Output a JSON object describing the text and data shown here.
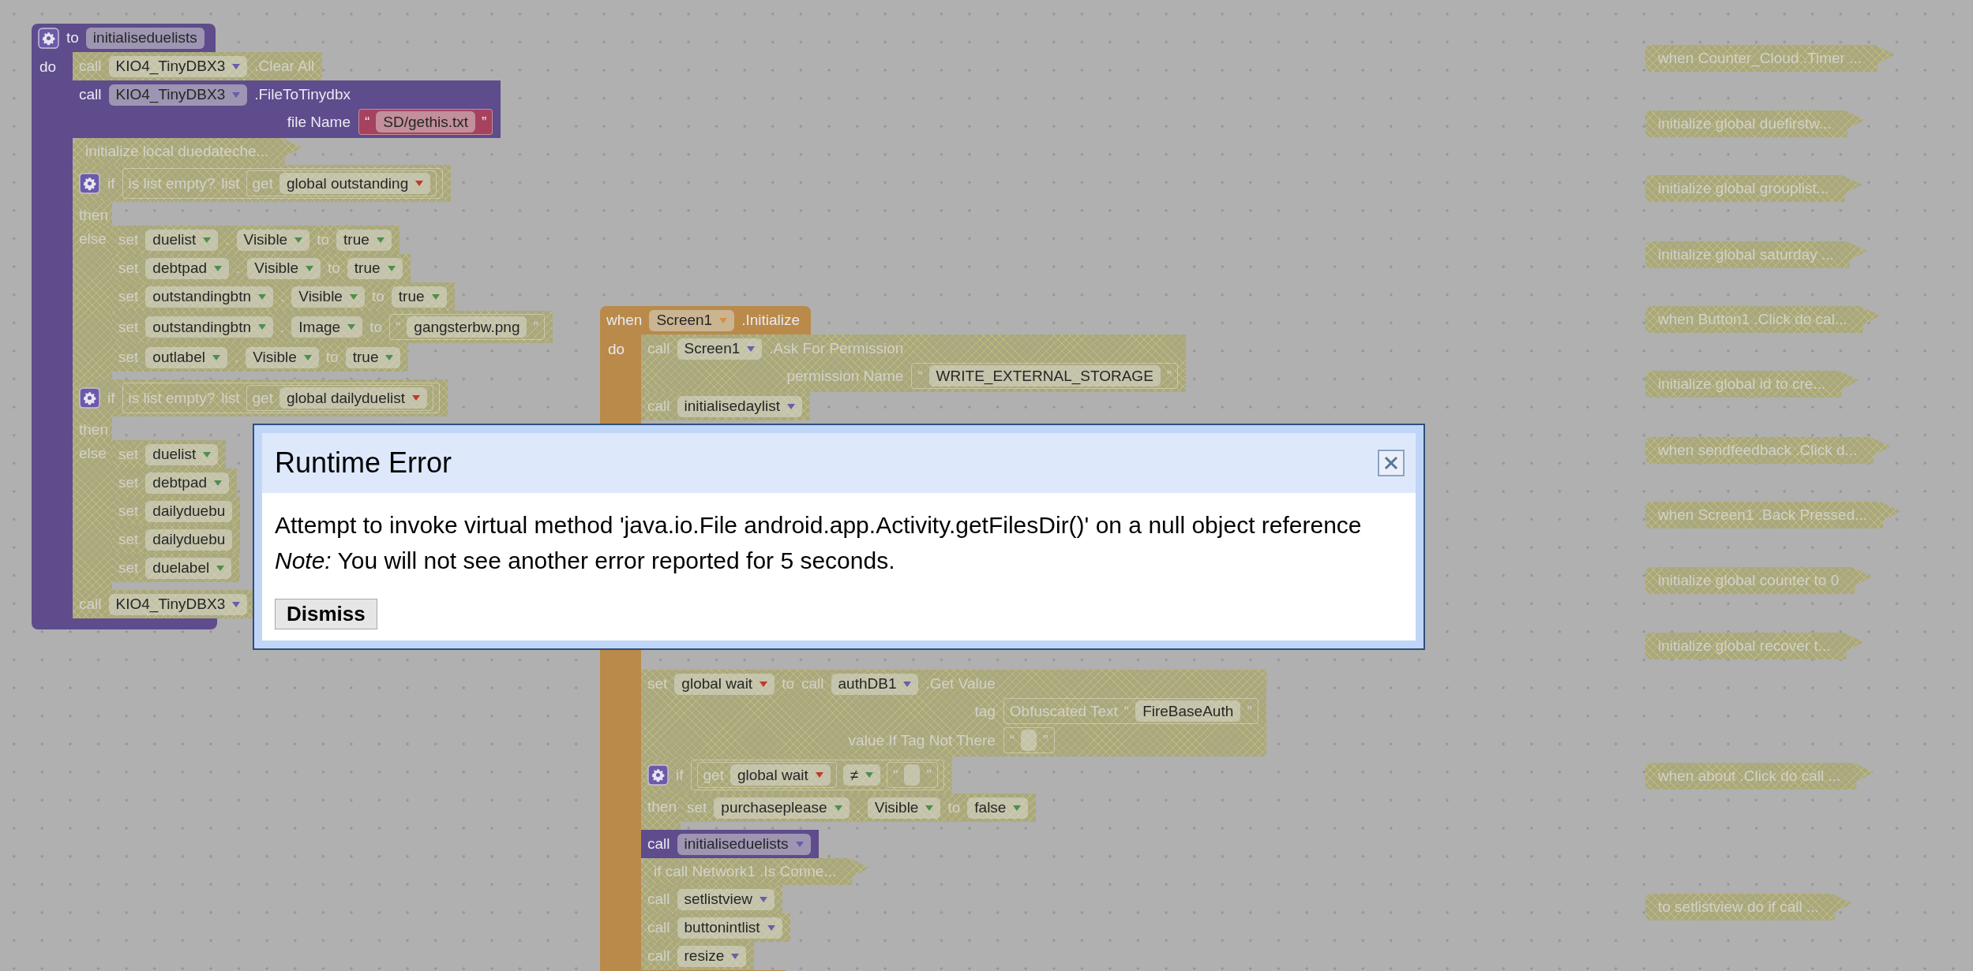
{
  "workspace": {
    "stacks": [
      {
        "kind": "procedure",
        "disabled": false,
        "color": "#5e4c8c",
        "header": [
          {
            "kind": "gear"
          },
          {
            "kind": "word",
            "text": "to"
          },
          {
            "kind": "field",
            "text": "initialiseduelists"
          }
        ],
        "body_label": "do",
        "rows": [
          {
            "kind": "statement",
            "disabled": true,
            "lines": [
              [
                {
                  "kind": "word",
                  "text": "call"
                },
                {
                  "kind": "field",
                  "text": "KIO4_TinyDBX3",
                  "color": "#6d5ca8"
                },
                {
                  "kind": "word",
                  "text": ".Clear All"
                }
              ]
            ]
          },
          {
            "kind": "statement",
            "disabled": false,
            "color": "#5e4c8c",
            "lines": [
              [
                {
                  "kind": "word",
                  "text": "call"
                },
                {
                  "kind": "field",
                  "text": "KIO4_TinyDBX3",
                  "color": "#6d5ca8"
                },
                {
                  "kind": "word",
                  "text": ".FileToTinydbx"
                }
              ],
              [
                {
                  "kind": "word",
                  "text": "file Name"
                },
                {
                  "kind": "value",
                  "color": "#a6415e",
                  "tokens": [
                    {
                      "kind": "word",
                      "text": "“"
                    },
                    {
                      "kind": "string",
                      "text": "SD/gethis.txt"
                    },
                    {
                      "kind": "word",
                      "text": "”"
                    }
                  ]
                }
              ]
            ]
          },
          {
            "kind": "collapsed",
            "disabled": true,
            "text": "initialize local duedateche..."
          },
          {
            "kind": "statement",
            "disabled": true,
            "lines": [
              [
                {
                  "kind": "gear"
                },
                {
                  "kind": "word",
                  "text": "if"
                },
                {
                  "kind": "value",
                  "tokens": [
                    {
                      "kind": "word",
                      "text": "is list empty?"
                    },
                    {
                      "kind": "word",
                      "text": "list"
                    },
                    {
                      "kind": "value",
                      "tokens": [
                        {
                          "kind": "word",
                          "text": "get"
                        },
                        {
                          "kind": "field",
                          "text": "global outstanding",
                          "color": "#c0392b"
                        }
                      ]
                    }
                  ]
                }
              ]
            ],
            "sections": [
              {
                "label": "then"
              },
              {
                "label": "else",
                "rows": [
                  {
                    "kind": "statement",
                    "disabled": true,
                    "lines": [
                      [
                        {
                          "kind": "word",
                          "text": "set"
                        },
                        {
                          "kind": "field",
                          "text": "duelist",
                          "color": "#4d8f4d"
                        },
                        {
                          "kind": "word",
                          "text": "."
                        },
                        {
                          "kind": "field",
                          "text": "Visible",
                          "color": "#4d8f4d"
                        },
                        {
                          "kind": "word",
                          "text": "to"
                        },
                        {
                          "kind": "field",
                          "text": "true",
                          "color": "#4d8f4d"
                        }
                      ]
                    ]
                  },
                  {
                    "kind": "statement",
                    "disabled": true,
                    "lines": [
                      [
                        {
                          "kind": "word",
                          "text": "set"
                        },
                        {
                          "kind": "field",
                          "text": "debtpad",
                          "color": "#4d8f4d"
                        },
                        {
                          "kind": "word",
                          "text": "."
                        },
                        {
                          "kind": "field",
                          "text": "Visible",
                          "color": "#4d8f4d"
                        },
                        {
                          "kind": "word",
                          "text": "to"
                        },
                        {
                          "kind": "field",
                          "text": "true",
                          "color": "#4d8f4d"
                        }
                      ]
                    ]
                  },
                  {
                    "kind": "statement",
                    "disabled": true,
                    "lines": [
                      [
                        {
                          "kind": "word",
                          "text": "set"
                        },
                        {
                          "kind": "field",
                          "text": "outstandingbtn",
                          "color": "#4d8f4d"
                        },
                        {
                          "kind": "word",
                          "text": "."
                        },
                        {
                          "kind": "field",
                          "text": "Visible",
                          "color": "#4d8f4d"
                        },
                        {
                          "kind": "word",
                          "text": "to"
                        },
                        {
                          "kind": "field",
                          "text": "true",
                          "color": "#4d8f4d"
                        }
                      ]
                    ]
                  },
                  {
                    "kind": "statement",
                    "disabled": true,
                    "lines": [
                      [
                        {
                          "kind": "word",
                          "text": "set"
                        },
                        {
                          "kind": "field",
                          "text": "outstandingbtn",
                          "color": "#4d8f4d"
                        },
                        {
                          "kind": "word",
                          "text": "."
                        },
                        {
                          "kind": "field",
                          "text": "Image",
                          "color": "#4d8f4d"
                        },
                        {
                          "kind": "word",
                          "text": "to"
                        },
                        {
                          "kind": "value",
                          "tokens": [
                            {
                              "kind": "word",
                              "text": "“"
                            },
                            {
                              "kind": "string",
                              "text": "gangsterbw.png"
                            },
                            {
                              "kind": "word",
                              "text": "”"
                            }
                          ]
                        }
                      ]
                    ]
                  },
                  {
                    "kind": "statement",
                    "disabled": true,
                    "lines": [
                      [
                        {
                          "kind": "word",
                          "text": "set"
                        },
                        {
                          "kind": "field",
                          "text": "outlabel",
                          "color": "#4d8f4d"
                        },
                        {
                          "kind": "word",
                          "text": "."
                        },
                        {
                          "kind": "field",
                          "text": "Visible",
                          "color": "#4d8f4d"
                        },
                        {
                          "kind": "word",
                          "text": "to"
                        },
                        {
                          "kind": "field",
                          "text": "true",
                          "color": "#4d8f4d"
                        }
                      ]
                    ]
                  }
                ]
              }
            ]
          },
          {
            "kind": "statement",
            "disabled": true,
            "lines": [
              [
                {
                  "kind": "gear"
                },
                {
                  "kind": "word",
                  "text": "if"
                },
                {
                  "kind": "value",
                  "tokens": [
                    {
                      "kind": "word",
                      "text": "is list empty?"
                    },
                    {
                      "kind": "word",
                      "text": "list"
                    },
                    {
                      "kind": "value",
                      "tokens": [
                        {
                          "kind": "word",
                          "text": "get"
                        },
                        {
                          "kind": "field",
                          "text": "global dailyduelist",
                          "color": "#c0392b"
                        }
                      ]
                    }
                  ]
                }
              ]
            ],
            "sections": [
              {
                "label": "then"
              },
              {
                "label": "else",
                "rows": [
                  {
                    "kind": "statement",
                    "disabled": true,
                    "lines": [
                      [
                        {
                          "kind": "word",
                          "text": "set"
                        },
                        {
                          "kind": "field",
                          "text": "duelist",
                          "color": "#4d8f4d"
                        }
                      ]
                    ]
                  },
                  {
                    "kind": "statement",
                    "disabled": true,
                    "lines": [
                      [
                        {
                          "kind": "word",
                          "text": "set"
                        },
                        {
                          "kind": "field",
                          "text": "debtpad",
                          "color": "#4d8f4d"
                        }
                      ]
                    ]
                  },
                  {
                    "kind": "statement",
                    "disabled": true,
                    "lines": [
                      [
                        {
                          "kind": "word",
                          "text": "set"
                        },
                        {
                          "kind": "field",
                          "text": "dailyduebu"
                        }
                      ]
                    ]
                  },
                  {
                    "kind": "statement",
                    "disabled": true,
                    "lines": [
                      [
                        {
                          "kind": "word",
                          "text": "set"
                        },
                        {
                          "kind": "field",
                          "text": "dailyduebu"
                        }
                      ]
                    ]
                  },
                  {
                    "kind": "statement",
                    "disabled": true,
                    "lines": [
                      [
                        {
                          "kind": "word",
                          "text": "set"
                        },
                        {
                          "kind": "field",
                          "text": "duelabel",
                          "color": "#4d8f4d"
                        }
                      ]
                    ]
                  }
                ]
              }
            ]
          },
          {
            "kind": "statement",
            "disabled": true,
            "lines": [
              [
                {
                  "kind": "word",
                  "text": "call"
                },
                {
                  "kind": "field",
                  "text": "KIO4_TinyDBX3",
                  "color": "#6d5ca8"
                }
              ]
            ]
          }
        ]
      },
      {
        "kind": "event",
        "disabled": false,
        "color": "#b98a4a",
        "header": [
          {
            "kind": "word",
            "text": "when"
          },
          {
            "kind": "field",
            "text": "Screen1",
            "color": "#d9903c"
          },
          {
            "kind": "word",
            "text": ".Initialize"
          }
        ],
        "body_label": "do",
        "rows": [
          {
            "kind": "statement",
            "disabled": true,
            "lines": [
              [
                {
                  "kind": "word",
                  "text": "call"
                },
                {
                  "kind": "field",
                  "text": "Screen1",
                  "color": "#6d5ca8"
                },
                {
                  "kind": "word",
                  "text": ".Ask For Permission"
                }
              ],
              [
                {
                  "kind": "word",
                  "text": "permission Name"
                },
                {
                  "kind": "value",
                  "tokens": [
                    {
                      "kind": "word",
                      "text": "“"
                    },
                    {
                      "kind": "string",
                      "text": "WRITE_EXTERNAL_STORAGE"
                    },
                    {
                      "kind": "word",
                      "text": "”"
                    }
                  ]
                }
              ]
            ]
          },
          {
            "kind": "statement",
            "disabled": true,
            "lines": [
              [
                {
                  "kind": "word",
                  "text": "call"
                },
                {
                  "kind": "field",
                  "text": "initialisedaylist",
                  "color": "#6d5ca8"
                }
              ]
            ]
          },
          {
            "kind": "statement",
            "disabled": true,
            "lines": [
              [
                {
                  "kind": "word",
                  "text": "set"
                },
                {
                  "kind": "field",
                  "text": "global wait",
                  "color": "#c0392b"
                },
                {
                  "kind": "word",
                  "text": "to"
                },
                {
                  "kind": "word",
                  "text": "call"
                },
                {
                  "kind": "field",
                  "text": "authDB1",
                  "color": "#6d5ca8"
                },
                {
                  "kind": "word",
                  "text": ".Get Value"
                }
              ],
              [
                {
                  "kind": "word",
                  "text": "tag"
                },
                {
                  "kind": "value",
                  "tokens": [
                    {
                      "kind": "word",
                      "text": "Obfuscated Text"
                    },
                    {
                      "kind": "word",
                      "text": "“"
                    },
                    {
                      "kind": "string",
                      "text": "FireBaseAuth"
                    },
                    {
                      "kind": "word",
                      "text": "”"
                    }
                  ]
                }
              ],
              [
                {
                  "kind": "word",
                  "text": "value If Tag Not There"
                },
                {
                  "kind": "value",
                  "tokens": [
                    {
                      "kind": "word",
                      "text": "“"
                    },
                    {
                      "kind": "empty"
                    },
                    {
                      "kind": "word",
                      "text": "”"
                    }
                  ]
                }
              ]
            ]
          },
          {
            "kind": "statement",
            "disabled": true,
            "lines": [
              [
                {
                  "kind": "gear"
                },
                {
                  "kind": "word",
                  "text": "if"
                },
                {
                  "kind": "value",
                  "tokens": [
                    {
                      "kind": "value",
                      "tokens": [
                        {
                          "kind": "word",
                          "text": "get"
                        },
                        {
                          "kind": "field",
                          "text": "global wait",
                          "color": "#c0392b"
                        }
                      ]
                    },
                    {
                      "kind": "field",
                      "text": "≠",
                      "color": "#4d8f4d"
                    },
                    {
                      "kind": "value",
                      "tokens": [
                        {
                          "kind": "word",
                          "text": "“"
                        },
                        {
                          "kind": "empty"
                        },
                        {
                          "kind": "word",
                          "text": "”"
                        }
                      ]
                    }
                  ]
                }
              ]
            ],
            "sections": [
              {
                "label": "then",
                "rows": [
                  {
                    "kind": "statement",
                    "disabled": true,
                    "lines": [
                      [
                        {
                          "kind": "word",
                          "text": "set"
                        },
                        {
                          "kind": "field",
                          "text": "purchaseplease",
                          "color": "#4d8f4d"
                        },
                        {
                          "kind": "word",
                          "text": "."
                        },
                        {
                          "kind": "field",
                          "text": "Visible",
                          "color": "#4d8f4d"
                        },
                        {
                          "kind": "word",
                          "text": "to"
                        },
                        {
                          "kind": "field",
                          "text": "false",
                          "color": "#4d8f4d"
                        }
                      ]
                    ]
                  }
                ]
              }
            ]
          },
          {
            "kind": "statement",
            "disabled": false,
            "color": "#5e4c8c",
            "lines": [
              [
                {
                  "kind": "word",
                  "text": "call"
                },
                {
                  "kind": "field",
                  "text": "initialiseduelists",
                  "color": "#6d5ca8"
                }
              ]
            ]
          },
          {
            "kind": "collapsed",
            "disabled": true,
            "text": "if call Network1 .Is Conne..."
          },
          {
            "kind": "statement",
            "disabled": true,
            "lines": [
              [
                {
                  "kind": "word",
                  "text": "call"
                },
                {
                  "kind": "field",
                  "text": "setlistview",
                  "color": "#6d5ca8"
                }
              ]
            ]
          },
          {
            "kind": "statement",
            "disabled": true,
            "lines": [
              [
                {
                  "kind": "word",
                  "text": "call"
                },
                {
                  "kind": "field",
                  "text": "buttonintlist",
                  "color": "#6d5ca8"
                }
              ]
            ]
          },
          {
            "kind": "statement",
            "disabled": true,
            "lines": [
              [
                {
                  "kind": "word",
                  "text": "call"
                },
                {
                  "kind": "field",
                  "text": "resize",
                  "color": "#6d5ca8"
                }
              ]
            ]
          }
        ]
      },
      {
        "kind": "collapsed",
        "disabled": true,
        "text": "when Counter_Cloud .Timer ..."
      },
      {
        "kind": "collapsed",
        "disabled": true,
        "text": "initialize global duefirstw..."
      },
      {
        "kind": "collapsed",
        "disabled": true,
        "text": "initialize global grouplist..."
      },
      {
        "kind": "collapsed",
        "disabled": true,
        "text": "initialize global saturday ..."
      },
      {
        "kind": "collapsed",
        "disabled": true,
        "text": "when Button1 .Click do cal..."
      },
      {
        "kind": "collapsed",
        "disabled": true,
        "text": "initialize global id to cre..."
      },
      {
        "kind": "collapsed",
        "disabled": true,
        "text": "when sendfeedback .Click d..."
      },
      {
        "kind": "collapsed",
        "disabled": true,
        "text": "when Screen1 .Back Pressed..."
      },
      {
        "kind": "collapsed",
        "disabled": true,
        "text": "initialize global counter to 0"
      },
      {
        "kind": "collapsed",
        "disabled": true,
        "text": "initialize global recover t..."
      },
      {
        "kind": "collapsed",
        "disabled": true,
        "text": "when about .Click do call ..."
      },
      {
        "kind": "collapsed",
        "disabled": true,
        "text": "to setlistview do if call ..."
      }
    ]
  },
  "dialog": {
    "title": "Runtime Error",
    "message": "Attempt to invoke virtual method 'java.io.File android.app.Activity.getFilesDir()' on a null object reference",
    "note": "*Note:* You will not see another error reported for 5 seconds.",
    "button": "Dismiss"
  }
}
